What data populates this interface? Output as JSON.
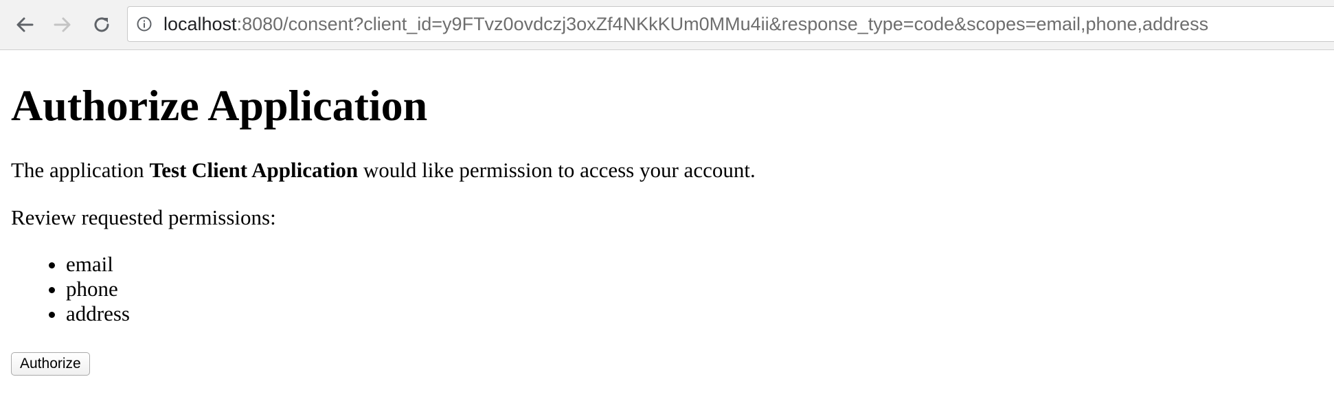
{
  "browser": {
    "url_host": "localhost",
    "url_rest": ":8080/consent?client_id=y9FTvz0ovdczj3oxZf4NKkKUm0MMu4ii&response_type=code&scopes=email,phone,address",
    "icons": {
      "back": "arrow-left-icon",
      "forward": "arrow-right-icon",
      "reload": "reload-icon",
      "info": "info-circle-icon"
    }
  },
  "page": {
    "title": "Authorize Application",
    "intro_prefix": "The application ",
    "app_name": "Test Client Application",
    "intro_suffix": " would like permission to access your account.",
    "review_label": "Review requested permissions:",
    "scopes": [
      "email",
      "phone",
      "address"
    ],
    "authorize_label": "Authorize"
  }
}
